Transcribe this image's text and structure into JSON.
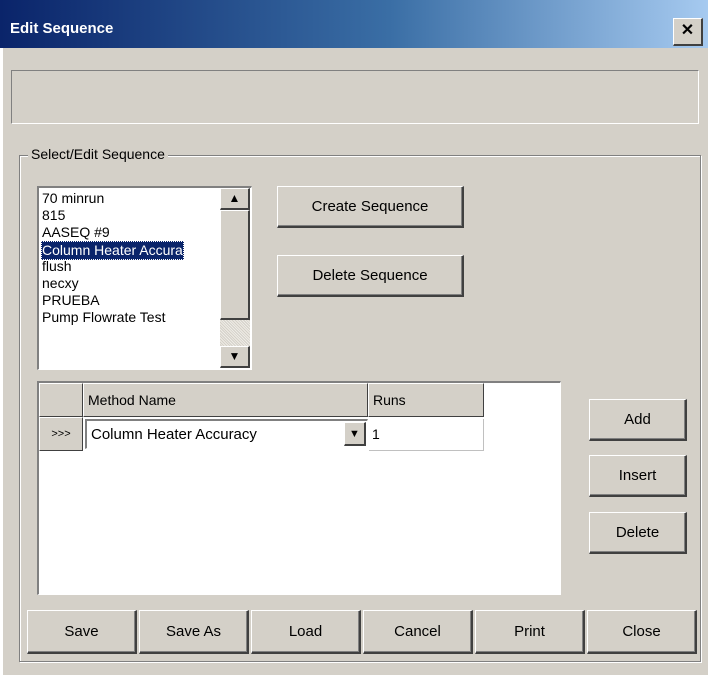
{
  "window": {
    "title": "Edit Sequence",
    "close_glyph": "✕"
  },
  "group": {
    "label": "Select/Edit Sequence"
  },
  "sequence_list": {
    "items": [
      "70 minrun",
      "815",
      "AASEQ #9",
      "Column Heater Accura",
      "flush",
      "necxy",
      "PRUEBA",
      "Pump Flowrate Test"
    ],
    "selected_index": 3,
    "scroll_up": "▲",
    "scroll_down": "▼"
  },
  "sequence_buttons": {
    "create": "Create Sequence",
    "delete": "Delete Sequence"
  },
  "table": {
    "headers": {
      "method": "Method Name",
      "runs": "Runs"
    },
    "rows": [
      {
        "marker": ">>>",
        "method": "Column Heater Accuracy",
        "runs": "1"
      }
    ],
    "combo_arrow": "▼"
  },
  "row_buttons": {
    "add": "Add",
    "insert": "Insert",
    "delete": "Delete"
  },
  "footer_buttons": {
    "save": "Save",
    "save_as": "Save As",
    "load": "Load",
    "cancel": "Cancel",
    "print": "Print",
    "close": "Close"
  },
  "colors": {
    "titlebar_start": "#0a246a",
    "face": "#d4d0c8",
    "selection": "#0a246a"
  }
}
